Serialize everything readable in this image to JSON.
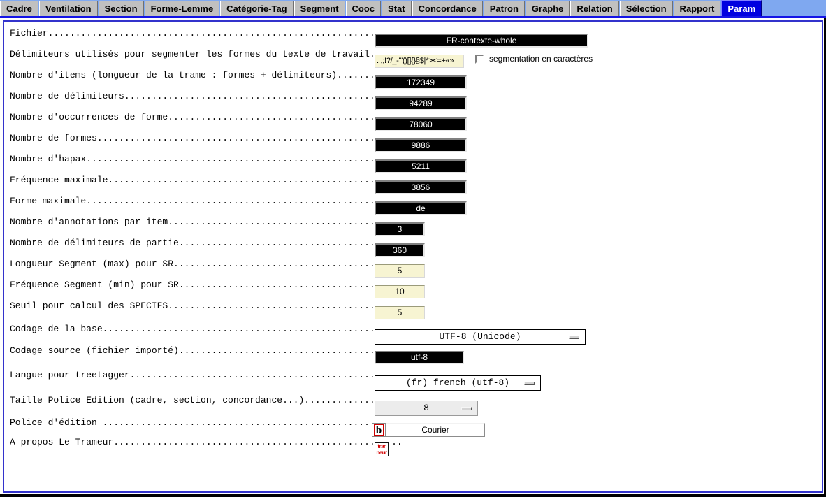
{
  "window": {
    "accent_blue": "#0000e0",
    "tabbar_bg": "#7fa8f0",
    "frame_border": "#3333cc"
  },
  "tabs": [
    {
      "label": "Cadre",
      "mnemonic": "C",
      "active": false
    },
    {
      "label": "Ventilation",
      "mnemonic": "V",
      "active": false
    },
    {
      "label": "Section",
      "mnemonic": "S",
      "active": false
    },
    {
      "label": "Forme-Lemme",
      "mnemonic": "F",
      "active": false
    },
    {
      "label": "Catégorie-Tag",
      "mnemonic": "a",
      "active": false
    },
    {
      "label": "Segment",
      "mnemonic": "S",
      "active": false
    },
    {
      "label": "Cooc",
      "mnemonic": "o",
      "active": false
    },
    {
      "label": "Stat",
      "mnemonic": "",
      "active": false
    },
    {
      "label": "Concordance",
      "mnemonic": "a",
      "active": false
    },
    {
      "label": "Patron",
      "mnemonic": "a",
      "active": false
    },
    {
      "label": "Graphe",
      "mnemonic": "G",
      "active": false
    },
    {
      "label": "Relation",
      "mnemonic": "i",
      "active": false
    },
    {
      "label": "Sélection",
      "mnemonic": "é",
      "active": false
    },
    {
      "label": "Rapport",
      "mnemonic": "R",
      "active": false
    },
    {
      "label": "Param",
      "mnemonic": "m",
      "active": true
    }
  ],
  "rows": [
    {
      "key": "fichier",
      "label": "Fichier.............................................................",
      "widget": "display",
      "value": "FR-contexte-whole"
    },
    {
      "key": "delimiteurs",
      "label": "Délimiteurs utilisés pour segmenter les formes du texte de travail.......",
      "widget": "entry",
      "value": ". ,;!?/_-'\"()[]{}§$|*><=+«»"
    },
    {
      "key": "nb_items",
      "label": "Nombre d'items (longueur de la trame : formes + délimiteurs).............",
      "widget": "display",
      "value": "172349"
    },
    {
      "key": "nb_delimiteurs",
      "label": "Nombre de délimiteurs...................................................",
      "widget": "display",
      "value": "94289"
    },
    {
      "key": "nb_occurrences",
      "label": "Nombre d'occurrences de forme...........................................",
      "widget": "display",
      "value": "78060"
    },
    {
      "key": "nb_formes",
      "label": "Nombre de formes........................................................",
      "widget": "display",
      "value": "9886"
    },
    {
      "key": "nb_hapax",
      "label": "Nombre d'hapax..........................................................",
      "widget": "display",
      "value": "5211"
    },
    {
      "key": "freq_max",
      "label": "Fréquence maximale......................................................",
      "widget": "display",
      "value": "3856"
    },
    {
      "key": "forme_max",
      "label": "Forme maximale..........................................................",
      "widget": "display",
      "value": "de"
    },
    {
      "key": "nb_annotations",
      "label": "Nombre d'annotations par item...........................................",
      "widget": "display-small",
      "value": "3"
    },
    {
      "key": "nb_delim_partie",
      "label": "Nombre de délimiteurs de partie.........................................",
      "widget": "display-small",
      "value": "360"
    },
    {
      "key": "longueur_segment",
      "label": "Longueur Segment (max) pour SR..........................................",
      "widget": "entry-small",
      "value": "5"
    },
    {
      "key": "frequence_segment",
      "label": "Fréquence Segment (min) pour SR.........................................",
      "widget": "entry-small",
      "value": "10"
    },
    {
      "key": "seuil_specifs",
      "label": "Seuil pour calcul des SPECIFS...........................................",
      "widget": "entry-small",
      "value": "5"
    },
    {
      "key": "codage_base",
      "label": "Codage de la base.......................................................",
      "widget": "optionmenu",
      "value": "UTF-8 (Unicode)"
    },
    {
      "key": "codage_source",
      "label": "Codage source (fichier importé).........................................",
      "widget": "display",
      "value": "utf-8"
    },
    {
      "key": "langue_treetagger",
      "label": "Langue pour treetagger..................................................",
      "widget": "optionmenu",
      "value": "(fr) french (utf-8)"
    },
    {
      "key": "taille_police",
      "label": "Taille Police Edition (cadre, section, concordance...)...................",
      "widget": "optionmenu-grey",
      "value": "8"
    },
    {
      "key": "police_edition",
      "label": "Police d'édition .......................................................",
      "widget": "fontpicker",
      "value": "Courier"
    },
    {
      "key": "a_propos",
      "label": "A propos Le Trameur.....................................................",
      "widget": "logo",
      "value": ""
    }
  ],
  "checkbox": {
    "label": "segmentation en caractères",
    "checked": false
  },
  "font_icon": {
    "glyph": "b"
  },
  "logo": {
    "line1": "trar",
    "line2": "neur"
  }
}
